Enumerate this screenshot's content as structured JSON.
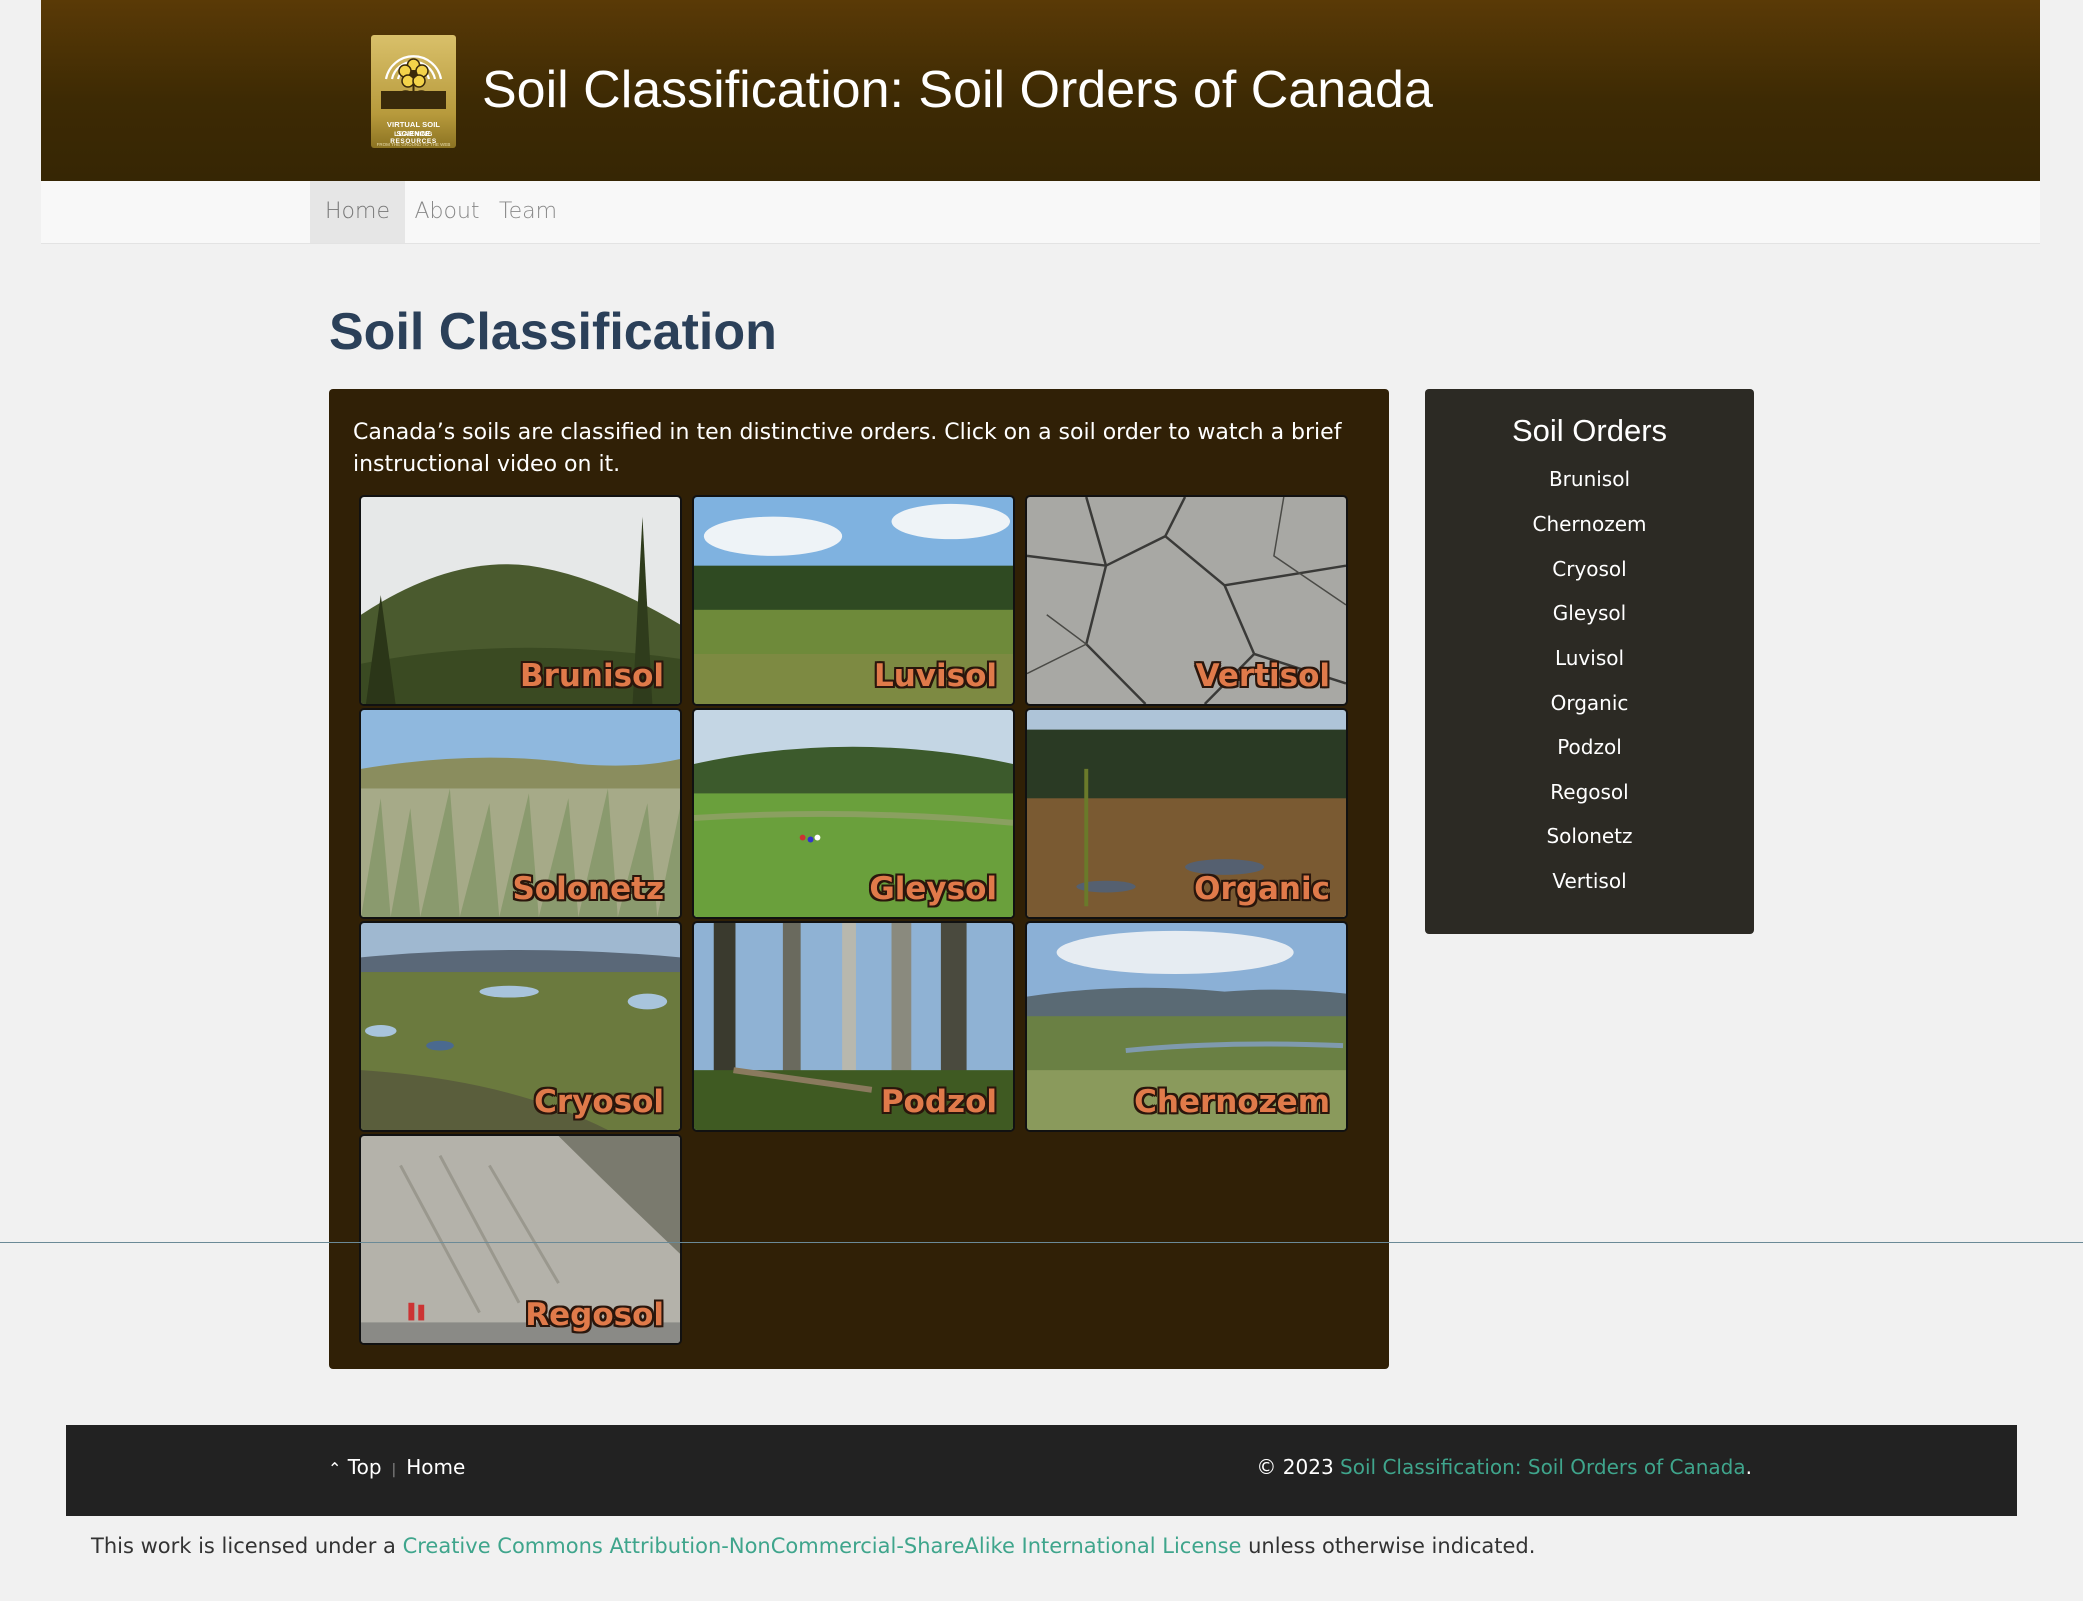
{
  "header": {
    "site_title": "Soil Classification: Soil Orders of Canada",
    "logo": {
      "line1": "VIRTUAL SOIL SCIENCE",
      "line2": "LEARNING RESOURCES",
      "line3": "FROM THE GROUND TO THE WEB"
    }
  },
  "nav": {
    "items": [
      {
        "label": "Home",
        "active": true
      },
      {
        "label": "About"
      },
      {
        "label": "Team"
      }
    ]
  },
  "main": {
    "page_title": "Soil Classification",
    "intro": "Canada’s soils are classified in ten distinctive orders. Click on a soil order to watch a brief instructional video on it.",
    "tiles": [
      {
        "label": "Brunisol"
      },
      {
        "label": "Luvisol"
      },
      {
        "label": "Vertisol"
      },
      {
        "label": "Solonetz"
      },
      {
        "label": "Gleysol"
      },
      {
        "label": "Organic"
      },
      {
        "label": "Cryosol"
      },
      {
        "label": "Podzol"
      },
      {
        "label": "Chernozem"
      },
      {
        "label": "Regosol"
      }
    ]
  },
  "sidebar": {
    "title": "Soil Orders",
    "items": [
      "Brunisol",
      "Chernozem",
      "Cryosol",
      "Gleysol",
      "Luvisol",
      "Organic",
      "Podzol",
      "Regosol",
      "Solonetz",
      "Vertisol"
    ]
  },
  "footer": {
    "top_label": "Top",
    "home_label": "Home",
    "copyright": "© 2023",
    "site_link": "Soil Classification: Soil Orders of Canada",
    "period": "."
  },
  "license": {
    "prefix": "This work is licensed under a",
    "link": "Creative Commons Attribution-NonCommercial-ShareAlike International License",
    "suffix": "unless otherwise indicated."
  },
  "colors": {
    "header_brown": "#3d2a04",
    "panel_brown": "#302006",
    "sidebar_dark": "#2c2a24",
    "title_blue": "#2b4059",
    "link_teal": "#3fa58c",
    "tile_label_orange": "#e07a4a"
  }
}
